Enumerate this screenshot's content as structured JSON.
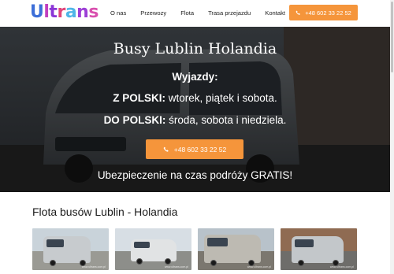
{
  "header": {
    "logo_text": "Ultrans",
    "logo_colors": [
      "#3d6fd8",
      "#c23fbf",
      "#8a35d6",
      "#e0457a",
      "#4fb6e8",
      "#9c3fd6",
      "#d94fae"
    ],
    "nav": [
      "O nas",
      "Przewozy",
      "Flota",
      "Trasa przejazdu",
      "Kontakt"
    ],
    "phone_button": "+48 602 33 22 52"
  },
  "hero": {
    "title": "Busy Lublin Holandia",
    "departures_label": "Wyjazdy:",
    "from_poland_label": "Z POLSKI:",
    "from_poland_days": "wtorek, piątek i sobota.",
    "to_poland_label": "DO POLSKI:",
    "to_poland_days": "środa, sobota i niedziela.",
    "phone_button": "+48 602 33 22 52",
    "insurance_text": "Ubezpieczenie na czas podróży GRATIS!"
  },
  "fleet": {
    "title": "Flota busów Lublin - Holandia",
    "watermark": "www.ultrans.com.pl"
  },
  "colors": {
    "accent": "#f5953b",
    "text_dark": "#1c1c1c"
  },
  "icons": {
    "phone": "phone-icon"
  }
}
